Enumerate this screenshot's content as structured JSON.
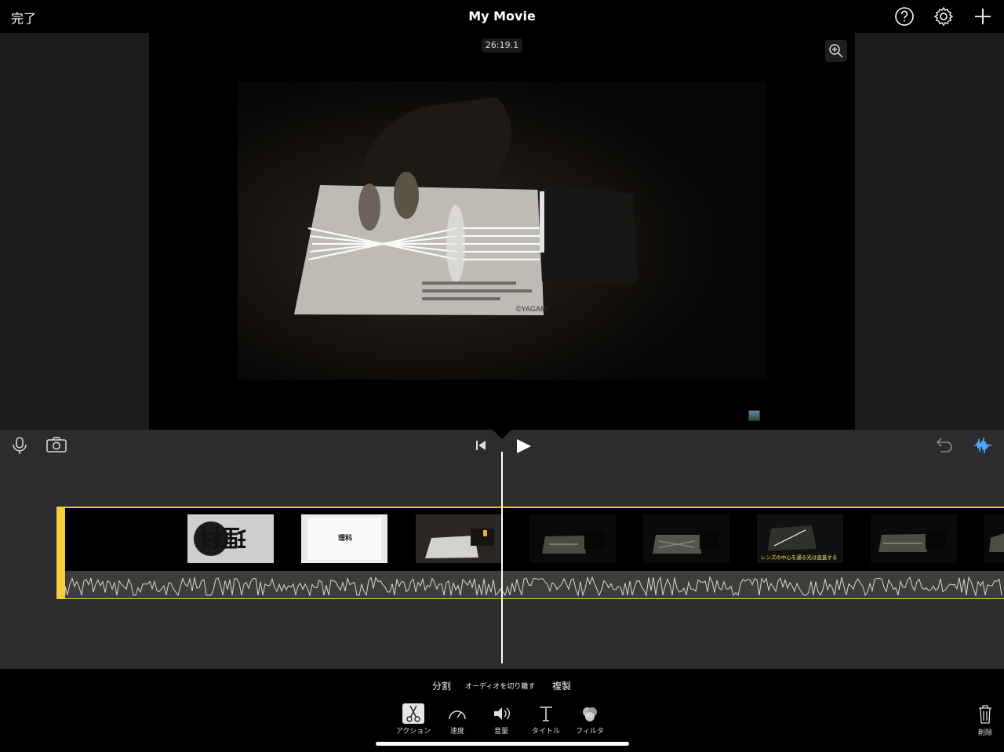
{
  "topbar": {
    "done_label": "完了",
    "title": "My Movie",
    "icons": [
      "help-icon",
      "gear-icon",
      "plus-icon"
    ]
  },
  "viewer": {
    "timecode": "26:19.1",
    "zoom_icon": "zoom-in-icon",
    "frame_text": {
      "brand": "©YAGAMI",
      "thumb2_text": "理科"
    }
  },
  "controls": {
    "icons": [
      "microphone-icon",
      "camera-icon",
      "skip-back-icon",
      "play-icon",
      "undo-icon",
      "waveform-icon"
    ]
  },
  "timeline": {
    "thumbs": [
      {
        "caption": "理科"
      },
      {
        "caption": "理科"
      },
      {
        "caption": ""
      },
      {
        "caption": ""
      },
      {
        "caption": ""
      },
      {
        "caption": "レンズの中心を通る光は直進する"
      },
      {
        "caption": ""
      },
      {
        "caption": ""
      }
    ]
  },
  "actions": {
    "split": "分割",
    "detach_audio": "オーディオを切り離す",
    "duplicate": "複製"
  },
  "tools": [
    {
      "label": "アクション",
      "icon": "scissors-icon",
      "active": true
    },
    {
      "label": "速度",
      "icon": "speedometer-icon",
      "active": false
    },
    {
      "label": "音量",
      "icon": "speaker-icon",
      "active": false
    },
    {
      "label": "タイトル",
      "icon": "title-t-icon",
      "active": false
    },
    {
      "label": "フィルタ",
      "icon": "filter-icon",
      "active": false
    }
  ],
  "delete_label": "削除",
  "colors": {
    "accent_yellow": "#f0cf3a",
    "waveform_blue": "#4da3ff",
    "panel": "#2c2c2e"
  }
}
